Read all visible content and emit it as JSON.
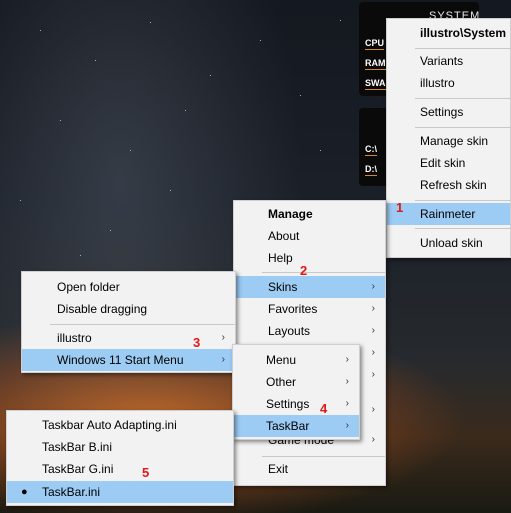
{
  "widgets": {
    "system": {
      "title": "SYSTEM",
      "lines": [
        "CPU",
        "RAM",
        "SWA"
      ]
    },
    "disk": {
      "lines": [
        "C:\\",
        "D:\\"
      ]
    }
  },
  "rainmeter_menu": {
    "header": "illustro\\System",
    "items": [
      "Variants",
      "illustro",
      "Settings",
      "Manage skin",
      "Edit skin",
      "Refresh skin",
      "Rainmeter",
      "Unload skin"
    ]
  },
  "main_menu": {
    "items": [
      "Manage",
      "About",
      "Help",
      "Skins",
      "Favorites",
      "Layouts",
      "Game mode",
      "Exit"
    ]
  },
  "skins_menu": {
    "items": [
      "Open folder",
      "Disable dragging",
      "illustro",
      "Windows 11 Start Menu"
    ]
  },
  "startmenu_menu": {
    "items": [
      "Menu",
      "Other",
      "Settings",
      "TaskBar"
    ]
  },
  "taskbar_menu": {
    "items": [
      "Taskbar Auto Adapting.ini",
      "TaskBar B.ini",
      "TaskBar G.ini",
      "TaskBar.ini"
    ],
    "bullet": "●"
  },
  "arrow": "›",
  "step_numbers": [
    "1",
    "2",
    "3",
    "4",
    "5"
  ],
  "colors": {
    "highlight": "#9ccbf4",
    "annotation": "#e01818",
    "menu_bg": "#f2f2f2"
  }
}
